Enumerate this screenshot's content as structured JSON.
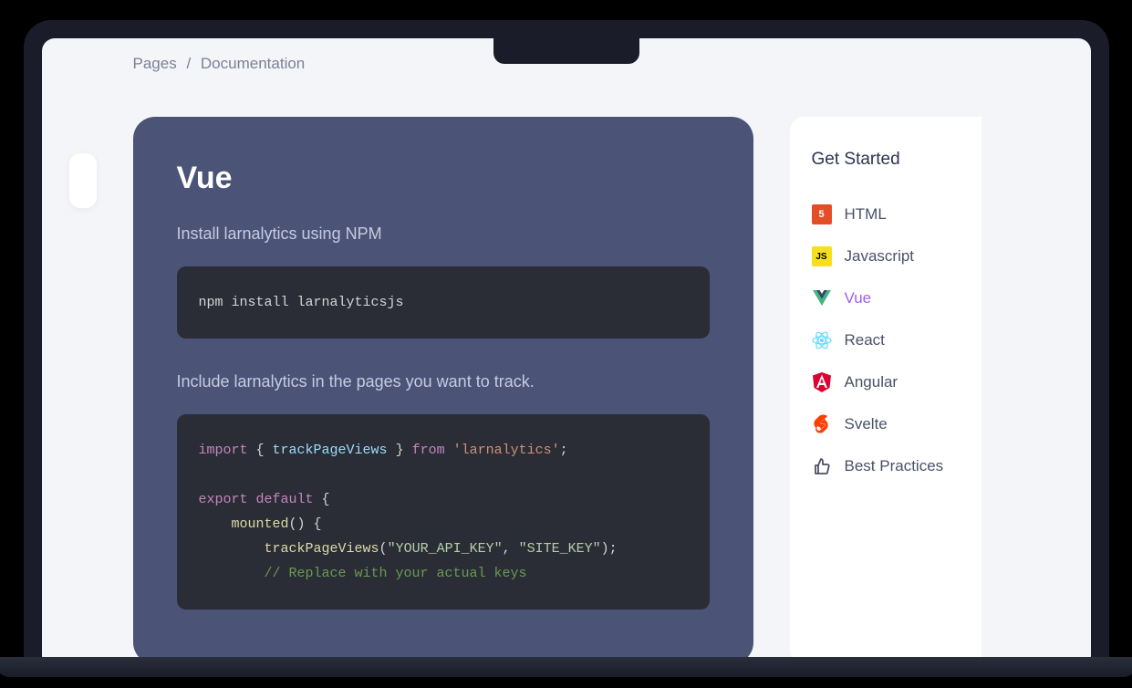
{
  "breadcrumb": {
    "root": "Pages",
    "sep": "/",
    "current": "Documentation"
  },
  "main": {
    "title": "Vue",
    "step1_text": "Install larnalytics using NPM",
    "code1": "npm install larnalyticsjs",
    "step2_text": "Include larnalytics in the pages you want to track.",
    "code2": {
      "l1_import": "import",
      "l1_brace_open": " { ",
      "l1_name": "trackPageViews",
      "l1_brace_close": " } ",
      "l1_from": "from",
      "l1_space": " ",
      "l1_str": "'larnalytics'",
      "l1_semi": ";",
      "l3_export": "export default",
      "l3_brace": " {",
      "l4_indent": "    ",
      "l4_mounted": "mounted",
      "l4_paren": "() {",
      "l5_indent": "        ",
      "l5_func": "trackPageViews",
      "l5_open": "(",
      "l5_arg1": "\"YOUR_API_KEY\"",
      "l5_comma": ", ",
      "l5_arg2": "\"SITE_KEY\"",
      "l5_close": ");",
      "l6_indent": "        ",
      "l6_comment": "// Replace with your actual keys"
    }
  },
  "sidebar": {
    "title": "Get Started",
    "items": [
      {
        "id": "html",
        "label": "HTML",
        "active": false
      },
      {
        "id": "javascript",
        "label": "Javascript",
        "active": false
      },
      {
        "id": "vue",
        "label": "Vue",
        "active": true
      },
      {
        "id": "react",
        "label": "React",
        "active": false
      },
      {
        "id": "angular",
        "label": "Angular",
        "active": false
      },
      {
        "id": "svelte",
        "label": "Svelte",
        "active": false
      },
      {
        "id": "best-practices",
        "label": "Best Practices",
        "active": false
      }
    ]
  }
}
